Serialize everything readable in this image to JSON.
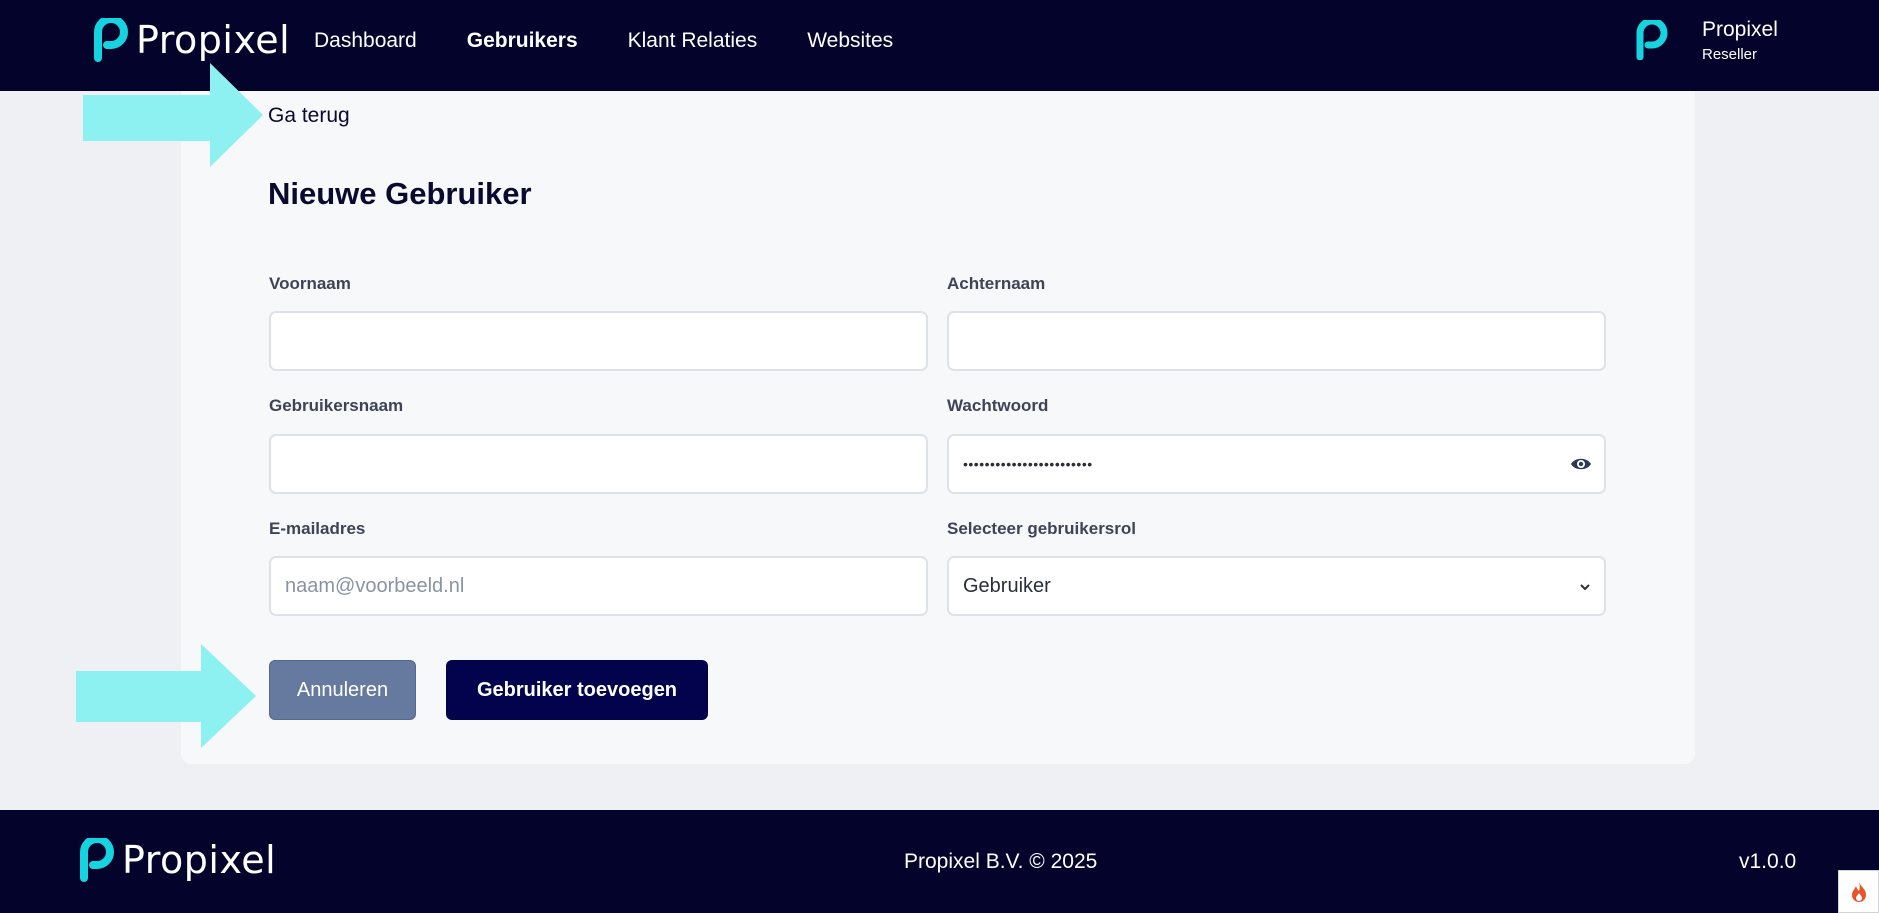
{
  "brand": {
    "name": "Propixel",
    "accent_color": "#16d3e0",
    "nav_bg": "#03032b"
  },
  "nav": {
    "items": [
      {
        "label": "Dashboard",
        "active": false
      },
      {
        "label": "Gebruikers",
        "active": true
      },
      {
        "label": "Klant Relaties",
        "active": false
      },
      {
        "label": "Websites",
        "active": false
      }
    ]
  },
  "user": {
    "name": "Propixel",
    "role": "Reseller"
  },
  "form": {
    "back_label": "Ga terug",
    "title": "Nieuwe Gebruiker",
    "first_name_label": "Voornaam",
    "first_name_value": "",
    "last_name_label": "Achternaam",
    "last_name_value": "",
    "username_label": "Gebruikersnaam",
    "username_value": "",
    "password_label": "Wachtwoord",
    "password_mask": "••••••••••••••••••••••••",
    "email_label": "E-mailadres",
    "email_placeholder": "naam@voorbeeld.nl",
    "role_label": "Selecteer gebruikersrol",
    "role_value": "Gebruiker",
    "cancel_label": "Annuleren",
    "submit_label": "Gebruiker toevoegen"
  },
  "footer": {
    "copyright": "Propixel B.V. © 2025",
    "version": "v1.0.0"
  },
  "annotations": {
    "arrow_color": "#8df1f1"
  }
}
